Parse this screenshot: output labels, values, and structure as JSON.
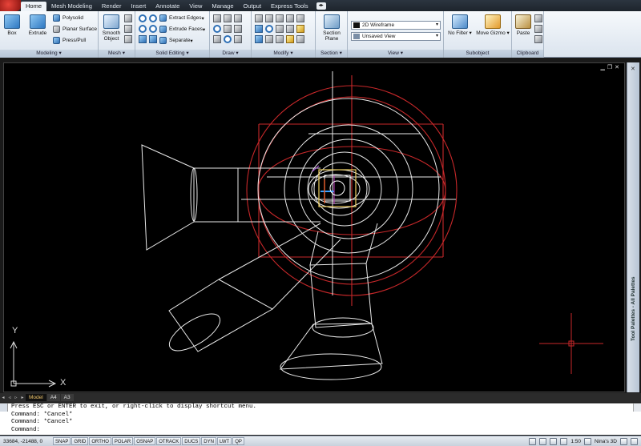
{
  "tabs": [
    "Home",
    "Mesh Modeling",
    "Render",
    "Insert",
    "Annotate",
    "View",
    "Manage",
    "Output",
    "Express Tools"
  ],
  "tab_extra": "◂▸",
  "ribbon": {
    "modeling": {
      "title": "Modeling",
      "box": "Box",
      "extrude": "Extrude",
      "polysolid": "Polysolid",
      "planar_surface": "Planar Surface",
      "press_pull": "Press/Pull"
    },
    "mesh": {
      "title": "Mesh",
      "smooth_object": "Smooth Object"
    },
    "solid_editing": {
      "title": "Solid Editing",
      "extract_edges": "Extract Edges",
      "extrude_faces": "Extrude Faces",
      "separate": "Separate"
    },
    "draw": {
      "title": "Draw"
    },
    "modify": {
      "title": "Modify"
    },
    "section": {
      "title": "Section",
      "section_plane": "Section Plane"
    },
    "view": {
      "title": "View",
      "visual_style": "2D Wireframe",
      "saved_view": "Unsaved View"
    },
    "subobject": {
      "title": "Subobject",
      "no_filter": "No Filter",
      "move_gizmo": "Move Gizmo"
    },
    "clipboard": {
      "title": "Clipboard",
      "paste": "Paste"
    }
  },
  "viewport": {
    "controls": [
      "▁",
      "❐",
      "✕"
    ],
    "ucs_y": "Y",
    "ucs_x": "X",
    "colors": {
      "wire": "#e8e8e8",
      "sphere": "#c8282a",
      "cursor": "#c8282a"
    }
  },
  "palette": {
    "label": "Tool Palettes - All Palettes",
    "close": "✕"
  },
  "layout_tabs": {
    "nav": [
      "◂",
      "◃",
      "▹",
      "▸"
    ],
    "tabs": [
      "Model",
      "A4",
      "A3"
    ],
    "active": "Model"
  },
  "command_lines": [
    "Press ESC or ENTER to exit, or right-click to display shortcut menu.",
    "Command: *Cancel*",
    "Command: *Cancel*",
    "Command:"
  ],
  "status": {
    "coords": "33684, -21488, 0",
    "buttons": [
      "SNAP",
      "GRID",
      "ORTHO",
      "POLAR",
      "OSNAP",
      "OTRACK",
      "DUCS",
      "DYN",
      "LWT",
      "QP"
    ],
    "scale": "1:50",
    "workspace": "Nina's 3D"
  }
}
